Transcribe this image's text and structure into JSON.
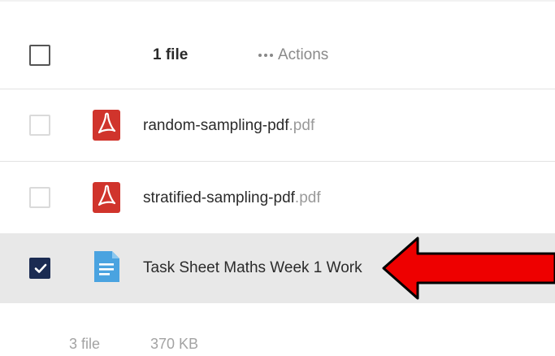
{
  "toolbar": {
    "selected_count": "1 file",
    "actions_label": "Actions"
  },
  "files": [
    {
      "name": "random-sampling-pdf",
      "ext": ".pdf",
      "type": "pdf-icon",
      "selected": false
    },
    {
      "name": "stratified-sampling-pdf",
      "ext": ".pdf",
      "type": "pdf-icon",
      "selected": false
    },
    {
      "name": "Task Sheet Maths Week 1 Work",
      "ext": "",
      "type": "document-icon",
      "selected": true
    }
  ],
  "footer": {
    "file_count": "3 file",
    "total_size": "370 KB"
  },
  "colors": {
    "accent": "#1b2b52",
    "pdf_red": "#d0342c",
    "doc_blue": "#4aa3e0",
    "arrow_red": "#ee0000"
  },
  "annotation": {
    "arrow_icon": "red-left-arrow"
  }
}
